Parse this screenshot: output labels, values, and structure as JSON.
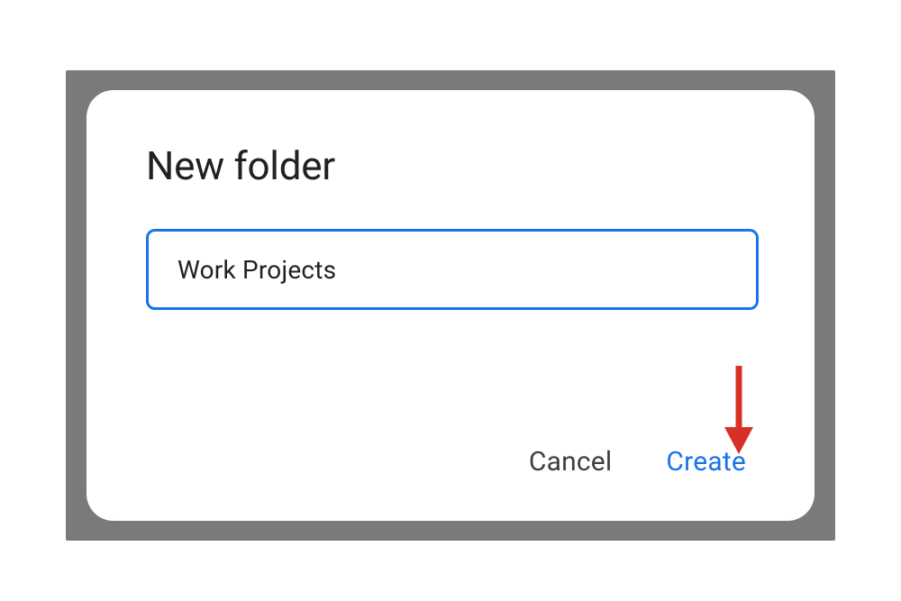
{
  "dialog": {
    "title": "New folder",
    "input_value": "Work Projects",
    "cancel_label": "Cancel",
    "create_label": "Create"
  },
  "colors": {
    "accent": "#1a73e8",
    "arrow": "#d93025"
  }
}
